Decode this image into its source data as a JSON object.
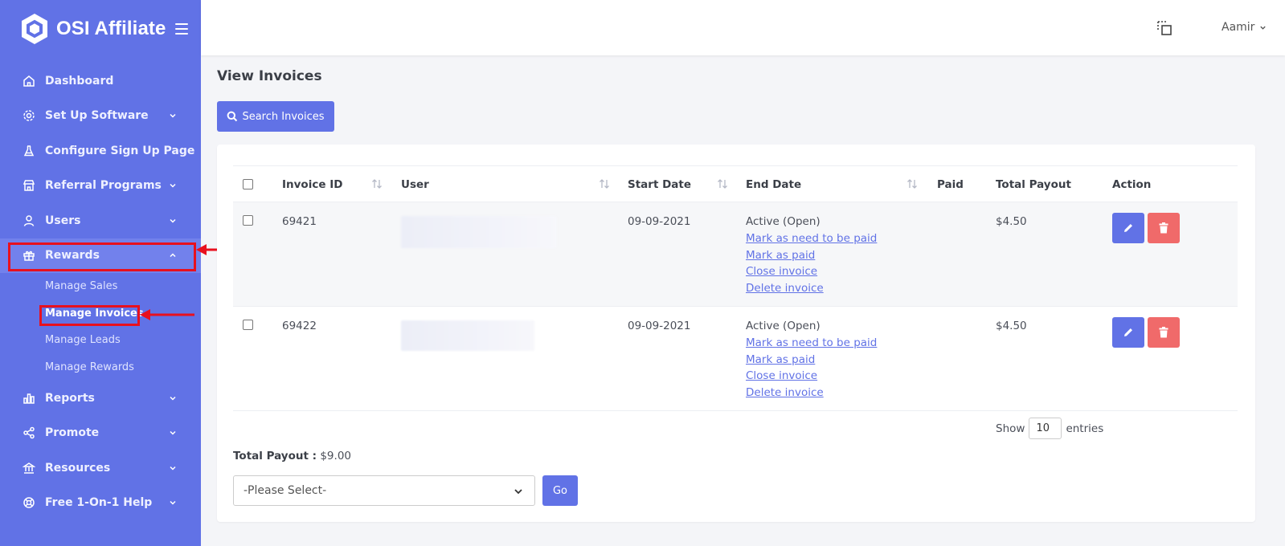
{
  "brand": {
    "name": "OSI Affiliate",
    "icon": "hexagon-logo-icon"
  },
  "colors": {
    "sidebar": "#6172e6",
    "primary": "#6172e6",
    "danger": "#f06a6a",
    "highlight": "#e8101e"
  },
  "sidebar": {
    "items": [
      {
        "label": "Dashboard",
        "icon": "home-icon"
      },
      {
        "label": "Set Up Software",
        "icon": "gear-icon"
      },
      {
        "label": "Configure Sign Up Page",
        "icon": "flask-icon"
      },
      {
        "label": "Referral Programs",
        "icon": "store-icon"
      },
      {
        "label": "Users",
        "icon": "user-icon"
      },
      {
        "label": "Rewards",
        "icon": "gift-icon"
      },
      {
        "label": "Reports",
        "icon": "bar-chart-icon"
      },
      {
        "label": "Promote",
        "icon": "share-icon"
      },
      {
        "label": "Resources",
        "icon": "bank-icon"
      },
      {
        "label": "Free 1-On-1 Help",
        "icon": "lifebuoy-icon"
      }
    ],
    "rewards_sub": [
      "Manage Sales",
      "Manage Invoices",
      "Manage Leads",
      "Manage Rewards"
    ]
  },
  "topbar": {
    "user": "Aamir"
  },
  "page": {
    "title": "View Invoices",
    "search_button": "Search Invoices"
  },
  "table": {
    "headers": [
      "Invoice ID",
      "User",
      "Start Date",
      "End Date",
      "Paid",
      "Total Payout",
      "Action"
    ],
    "rows": [
      {
        "id": "69421",
        "start": "09-09-2021",
        "status": "Active (Open)",
        "links": [
          "Mark as need to be paid",
          "Mark as paid",
          "Close invoice",
          "Delete invoice"
        ],
        "payout": "$4.50"
      },
      {
        "id": "69422",
        "start": "09-09-2021",
        "status": "Active (Open)",
        "links": [
          "Mark as need to be paid",
          "Mark as paid",
          "Close invoice",
          "Delete invoice"
        ],
        "payout": "$4.50"
      }
    ]
  },
  "entries": {
    "show": "Show",
    "value": "10",
    "suffix": "entries"
  },
  "total_payout": {
    "label": "Total Payout :",
    "value": "$9.00"
  },
  "bulk": {
    "select_placeholder": "-Please Select-",
    "go": "Go"
  }
}
